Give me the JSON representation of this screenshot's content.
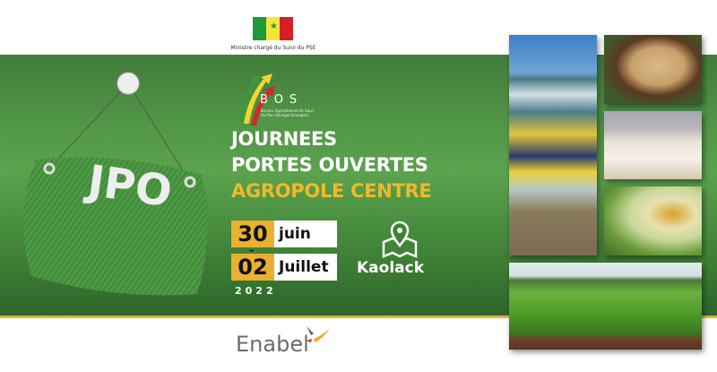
{
  "header": {
    "ministry": "Ministre chargé du Suivi du PSE",
    "flag_colors": [
      "#1f9a3a",
      "#f5e43b",
      "#d51f26"
    ]
  },
  "bos": {
    "name": "BOS",
    "subtitle": "Bureau Opérationnel de Suivi du Plan Sénégal Emergent"
  },
  "sign": {
    "logo_text": "JPO"
  },
  "title": {
    "line1": "JOURNEES",
    "line2": "PORTES OUVERTES",
    "line3": "AGROPOLE CENTRE"
  },
  "dates": {
    "start_day": "30",
    "start_month": "juin",
    "end_day": "02",
    "end_month": "Juillet",
    "year": "2022"
  },
  "location": {
    "icon": "map-pin-icon",
    "city": "Kaolack"
  },
  "partner": {
    "name": "Enabel"
  },
  "colors": {
    "green": "#4f9444",
    "gold": "#e9b031"
  }
}
